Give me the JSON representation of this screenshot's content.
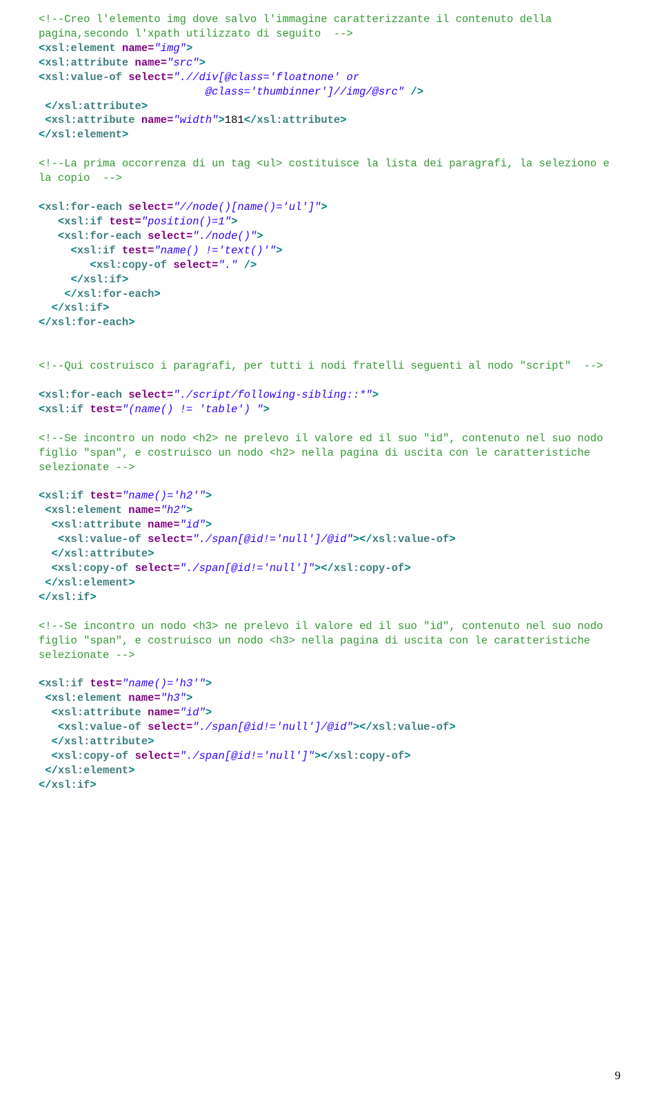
{
  "page_number": "9",
  "code": {
    "l01": "<!--Creo l'elemento img dove salvo l'immagine caratterizzante il contenuto della pagina,secondo l'xpath utilizzato di seguito  -->",
    "l02a_tag": "xsl:element",
    "l02a_attr": "name=",
    "l02a_val": "\"img\"",
    "l02b_tag": "xsl:attribute",
    "l02b_attr": "name=",
    "l02b_val": "\"src\"",
    "l02c_tag": "xsl:value-of",
    "l02c_attr": "select=",
    "l02c_val": "\".//div[@class='floatnone' or",
    "l02c_val2": "@class='thumbinner']//img/@src\"",
    "l02d_end_attr": "xsl:attribute",
    "l02e_tag": "xsl:attribute",
    "l02e_attr": "name=",
    "l02e_val": "\"width\"",
    "l02e_text": "181",
    "l02e_end": "xsl:attribute",
    "l02f_end": "xsl:element",
    "l03": "<!--La prima occorrenza di un tag <ul> costituisce la lista dei paragrafi, la seleziono e la copio  -->",
    "l04a_tag": "xsl:for-each",
    "l04a_attr": "select=",
    "l04a_val": "\"//node()[name()='ul']\"",
    "l04b_tag": "xsl:if",
    "l04b_attr": "test=",
    "l04b_val": "\"position()=1\"",
    "l04c_tag": "xsl:for-each",
    "l04c_attr": "select=",
    "l04c_val": "\"./node()\"",
    "l04d_tag": "xsl:if",
    "l04d_attr": "test=",
    "l04d_val": "\"name() !='text()'\"",
    "l04e_tag": "xsl:copy-of",
    "l04e_attr": "select=",
    "l04e_val": "\".\"",
    "l04f_end": "xsl:if",
    "l04g_end": "xsl:for-each",
    "l04h_end": "xsl:if",
    "l04i_end": "xsl:for-each",
    "l05": "<!--Qui costruisco i paragrafi, per tutti i nodi fratelli seguenti al nodo \"script\"  -->",
    "l06a_tag": "xsl:for-each",
    "l06a_attr": "select=",
    "l06a_val": "\"./script/following-sibling::*\"",
    "l06b_tag": "xsl:if",
    "l06b_attr": "test=",
    "l06b_val": "\"(name() != 'table') \"",
    "l07": "<!--Se incontro un nodo <h2> ne prelevo il valore ed il suo \"id\", contenuto nel suo nodo figlio \"span\", e costruisco un nodo <h2> nella pagina di uscita con le caratteristiche selezionate -->",
    "l08a_tag": "xsl:if",
    "l08a_attr": "test=",
    "l08a_val": "\"name()='h2'\"",
    "l08b_tag": "xsl:element",
    "l08b_attr": "name=",
    "l08b_val": "\"h2\"",
    "l08c_tag": "xsl:attribute",
    "l08c_attr": "name=",
    "l08c_val": "\"id\"",
    "l08d_tag": "xsl:value-of",
    "l08d_attr": "select=",
    "l08d_val": "\"./span[@id!='null']/@id\"",
    "l08d_end": "xsl:value-of",
    "l08e_end": "xsl:attribute",
    "l08f_tag": "xsl:copy-of",
    "l08f_attr": "select=",
    "l08f_val": "\"./span[@id!='null']\"",
    "l08f_end": "xsl:copy-of",
    "l08g_end": "xsl:element",
    "l08h_end": "xsl:if",
    "l09": "<!--Se incontro un nodo <h3> ne prelevo il valore ed il suo \"id\", contenuto nel suo nodo figlio \"span\", e costruisco un nodo <h3> nella pagina di uscita con le caratteristiche selezionate -->",
    "l10a_tag": "xsl:if",
    "l10a_attr": "test=",
    "l10a_val": "\"name()='h3'\"",
    "l10b_tag": "xsl:element",
    "l10b_attr": "name=",
    "l10b_val": "\"h3\"",
    "l10c_tag": "xsl:attribute",
    "l10c_attr": "name=",
    "l10c_val": "\"id\"",
    "l10d_tag": "xsl:value-of",
    "l10d_attr": "select=",
    "l10d_val": "\"./span[@id!='null']/@id\"",
    "l10d_end": "xsl:value-of",
    "l10e_end": "xsl:attribute",
    "l10f_tag": "xsl:copy-of",
    "l10f_attr": "select=",
    "l10f_val": "\"./span[@id!='null']\"",
    "l10f_end": "xsl:copy-of",
    "l10g_end": "xsl:element",
    "l10h_end": "xsl:if"
  }
}
